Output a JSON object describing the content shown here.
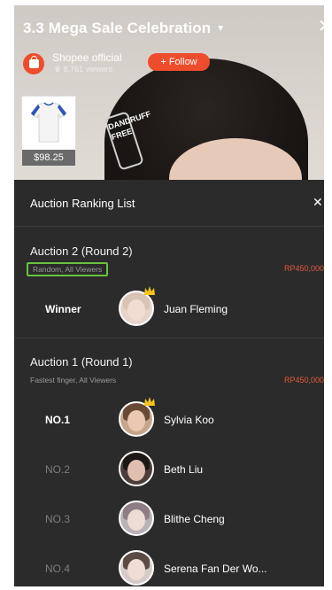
{
  "live": {
    "title": "3.3 Mega Sale Celebration",
    "host_name": "Shopee official",
    "viewers": "♛ 8,761 viewers",
    "follow_label": "+ Follow",
    "hair_clip_text": "DANDRUFF FREE",
    "product_price": "$98.25"
  },
  "panel": {
    "title": "Auction Ranking List",
    "sections": [
      {
        "title": "Auction 2 (Round 2)",
        "subtitle": "Random, All Viewers",
        "amount": "RP450,000",
        "rows": [
          {
            "label": "Winner",
            "name": "Juan Fleming"
          }
        ]
      },
      {
        "title": "Auction 1 (Round 1)",
        "subtitle": "Fastest finger, All Viewers",
        "amount": "RP450,000",
        "rows": [
          {
            "label": "NO.1",
            "name": "Sylvia Koo"
          },
          {
            "label": "NO.2",
            "name": "Beth Liu"
          },
          {
            "label": "NO.3",
            "name": "Blithe Cheng"
          },
          {
            "label": "NO.4",
            "name": "Serena Fan Der Wo..."
          }
        ]
      }
    ]
  },
  "colors": {
    "accent": "#ee4d2d",
    "amount": "#e15a3a",
    "highlight_box": "#69c13f",
    "panel_bg": "#2b2b2b"
  },
  "icons": [
    "chevron-down-icon",
    "close-icon",
    "shopee-bag-icon",
    "crown-icon",
    "shirt-icon"
  ]
}
